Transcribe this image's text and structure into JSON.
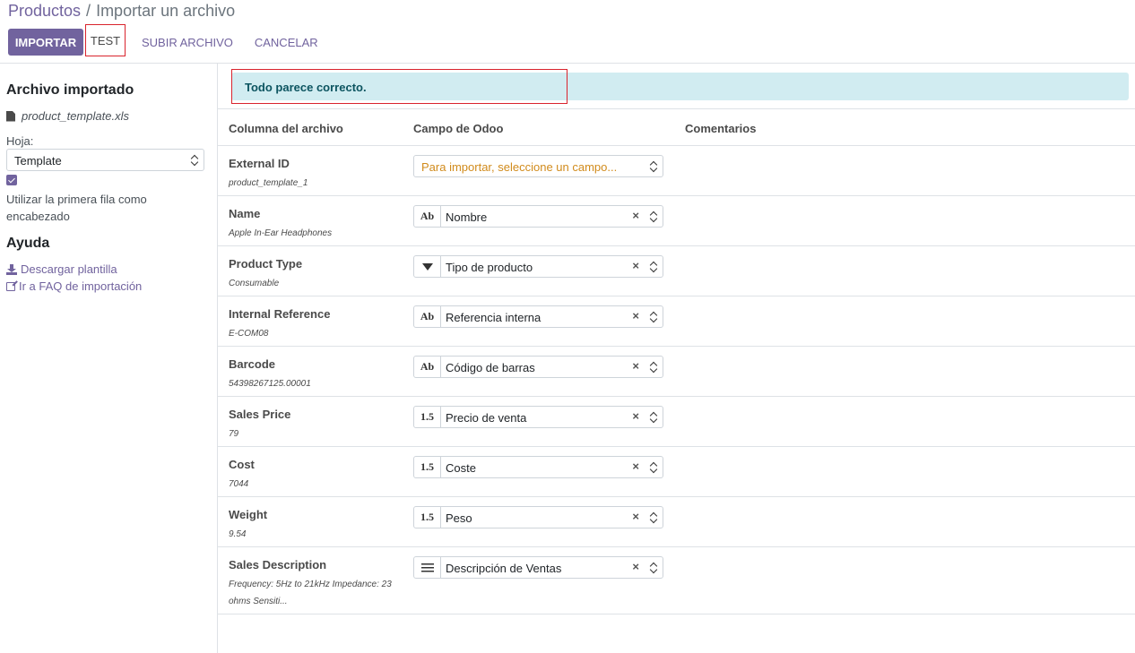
{
  "breadcrumb": {
    "parent": "Productos",
    "separator": "/",
    "current": "Importar un archivo"
  },
  "toolbar": {
    "import_label": "IMPORTAR",
    "test_label": "TEST",
    "upload_label": "SUBIR ARCHIVO",
    "cancel_label": "CANCELAR"
  },
  "sidebar": {
    "imported_title": "Archivo importado",
    "file_name": "product_template.xls",
    "sheet_label": "Hoja:",
    "sheet_value": "Template",
    "first_row_checked": true,
    "first_row_label": "Utilizar la primera fila como encabezado",
    "help_title": "Ayuda",
    "download_template": "Descargar plantilla",
    "faq_link": "Ir a FAQ de importación"
  },
  "alert": {
    "message": "Todo parece correcto."
  },
  "table": {
    "headers": {
      "file_column": "Columna del archivo",
      "odoo_field": "Campo de Odoo",
      "comments": "Comentarios"
    },
    "rows": [
      {
        "name": "External ID",
        "sample": "product_template_1",
        "field": "Para importar, seleccione un campo...",
        "icon": "none",
        "placeholder": true
      },
      {
        "name": "Name",
        "sample": "Apple In-Ear Headphones",
        "field": "Nombre",
        "icon": "Ab"
      },
      {
        "name": "Product Type",
        "sample": "Consumable",
        "field": "Tipo de producto",
        "icon": "triangle-down-icon"
      },
      {
        "name": "Internal Reference",
        "sample": "E-COM08",
        "field": "Referencia interna",
        "icon": "Ab"
      },
      {
        "name": "Barcode",
        "sample": "54398267125.00001",
        "field": "Código de barras",
        "icon": "Ab"
      },
      {
        "name": "Sales Price",
        "sample": "79",
        "field": "Precio de venta",
        "icon": "1.5"
      },
      {
        "name": "Cost",
        "sample": "7044",
        "field": "Coste",
        "icon": "1.5"
      },
      {
        "name": "Weight",
        "sample": "9.54",
        "field": "Peso",
        "icon": "1.5"
      },
      {
        "name": "Sales Description",
        "sample": "Frequency: 5Hz to 21kHz Impedance: 23 ohms Sensiti...",
        "field": "Descripción de Ventas",
        "icon": "lines-icon"
      }
    ],
    "clear_symbol": "×"
  },
  "colors": {
    "brand": "#71639e",
    "alert_bg": "#d1ecf1",
    "alert_text": "#0c5460",
    "placeholder_text": "#d18b1c",
    "highlight_border": "#d9232d"
  }
}
